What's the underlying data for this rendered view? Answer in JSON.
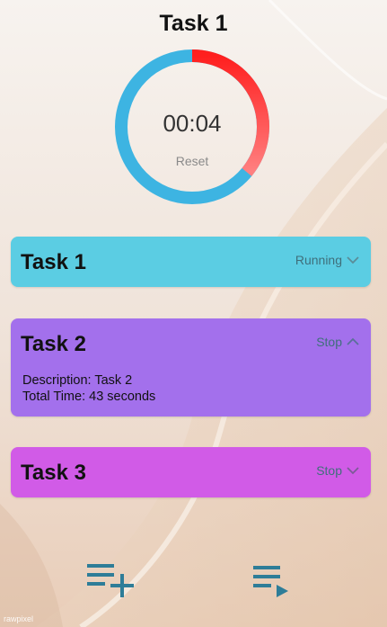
{
  "app": {
    "active_task_title": "Task 1"
  },
  "timer": {
    "display": "00:04",
    "reset_label": "Reset",
    "progress_fraction": 0.36,
    "ring_colors": {
      "remaining": "#3db4e2",
      "elapsed_start": "#ff1f1f",
      "elapsed_end": "#ff8080"
    }
  },
  "tasks": [
    {
      "title": "Task 1",
      "status": "Running",
      "expanded": false,
      "color": "#5bcde3"
    },
    {
      "title": "Task 2",
      "status": "Stop",
      "expanded": true,
      "color": "#a370ec",
      "description": "Description: Task 2",
      "total_time": "Total Time: 43 seconds"
    },
    {
      "title": "Task 3",
      "status": "Stop",
      "expanded": false,
      "color": "#d15be7"
    }
  ],
  "bottom_bar": {
    "add_icon": "playlist-add-icon",
    "play_icon": "playlist-play-icon",
    "icon_color": "#2e7d98"
  },
  "watermark": "rawpixel"
}
